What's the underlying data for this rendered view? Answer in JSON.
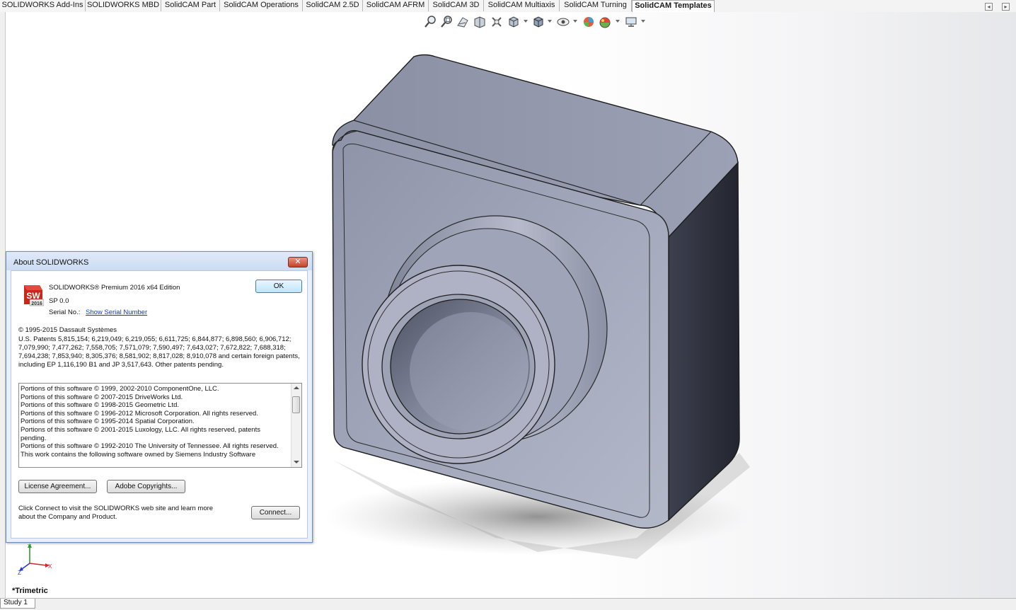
{
  "command_tabs": [
    {
      "label": "SOLIDWORKS Add-Ins",
      "active": false
    },
    {
      "label": "SOLIDWORKS MBD",
      "active": false
    },
    {
      "label": "SolidCAM Part",
      "active": false
    },
    {
      "label": "SolidCAM Operations",
      "active": false
    },
    {
      "label": "SolidCAM 2.5D",
      "active": false
    },
    {
      "label": "SolidCAM AFRM",
      "active": false
    },
    {
      "label": "SolidCAM 3D",
      "active": false
    },
    {
      "label": "SolidCAM Multiaxis",
      "active": false
    },
    {
      "label": "SolidCAM Turning",
      "active": false
    },
    {
      "label": "SolidCAM Templates",
      "active": true
    }
  ],
  "view_toolbar_icons": [
    "zoom-to-fit-icon",
    "zoom-to-area-icon",
    "previous-view-icon",
    "section-view-icon",
    "dynamic-annotation-icon",
    "view-orientation-icon",
    "display-style-icon",
    "hide-show-items-icon",
    "edit-appearance-icon",
    "apply-scene-icon",
    "view-settings-icon"
  ],
  "about_dialog": {
    "title": "About SOLIDWORKS",
    "close_glyph": "✕",
    "product": "SOLIDWORKS® Premium 2016 x64 Edition",
    "sp": "SP 0.0",
    "serial_label": "Serial No.:",
    "serial_link": "Show Serial Number",
    "ok_label": "OK",
    "logo_text": "SW",
    "logo_year": "2016",
    "copyright": "© 1995-2015 Dassault Systèmes",
    "patents": "U.S. Patents 5,815,154; 6,219,049; 6,219,055; 6,611,725; 6,844,877; 6,898,560; 6,906,712; 7,079,990; 7,477,262; 7,558,705; 7,571,079; 7,590,497; 7,643,027; 7,672,822; 7,688,318; 7,694,238; 7,853,940; 8,305,376; 8,581,902; 8,817,028; 8,910,078 and certain foreign patents, including EP 1,116,190 B1 and JP 3,517,643. Other patents pending.",
    "third_party_lines": [
      "Portions of this software © 1999, 2002-2010 ComponentOne, LLC.",
      "Portions of this software © 2007-2015 DriveWorks Ltd.",
      "Portions of this software © 1998-2015 Geometric Ltd.",
      "Portions of this software © 1996-2012 Microsoft Corporation. All rights reserved.",
      "Portions of this software © 1995-2014 Spatial Corporation.",
      "Portions of this software © 2001-2015 Luxology, LLC. All rights reserved, patents pending.",
      "Portions of this software © 1992-2010 The University of Tennessee. All rights reserved.",
      "This work contains the following software owned by Siemens Industry Software"
    ],
    "license_button": "License Agreement...",
    "adobe_button": "Adobe Copyrights...",
    "connect_text_1": "Click Connect to visit the SOLIDWORKS web site and learn more",
    "connect_text_2": "about the Company and Product.",
    "connect_button": "Connect..."
  },
  "triad": {
    "x": "X",
    "y": "Y",
    "z": "Z"
  },
  "view_orientation_label": "*Trimetric",
  "bottom_tabs": [
    {
      "label": "Study 1"
    }
  ],
  "colors": {
    "model_face": "#9aa0b6",
    "model_dark_side": "#2b2e39",
    "dialog_bg": "#e8f0fb",
    "link": "#0b3cc8",
    "close_button": "#c4432a"
  }
}
